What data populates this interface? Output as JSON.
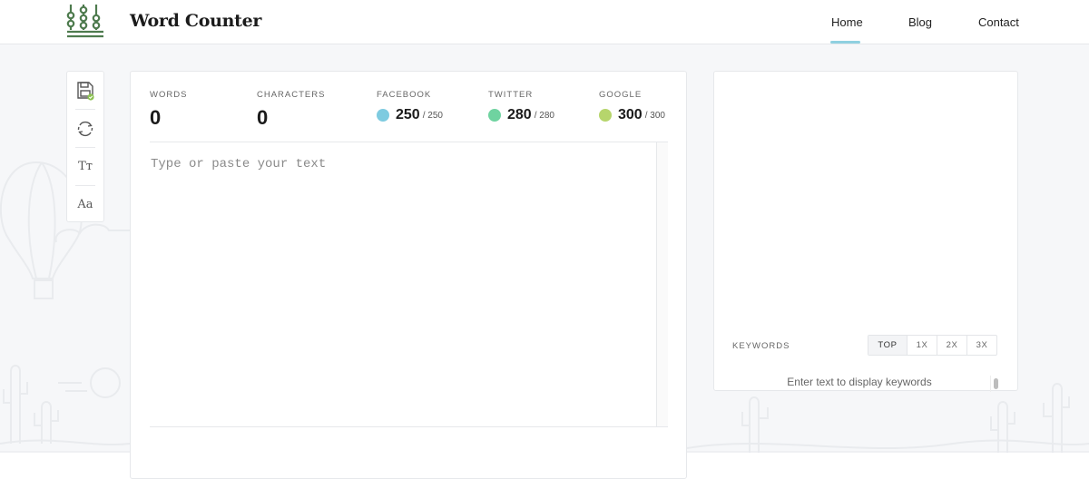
{
  "header": {
    "brand": "Word Counter",
    "nav": {
      "home": "Home",
      "blog": "Blog",
      "contact": "Contact"
    }
  },
  "toolbar": {
    "items": [
      {
        "icon": "save-icon"
      },
      {
        "icon": "refresh-icon"
      },
      {
        "label": "Tт",
        "icon": "text-size-icon"
      },
      {
        "label": "Aa",
        "icon": "font-icon"
      }
    ]
  },
  "stats": {
    "words": {
      "label": "WORDS",
      "value": "0"
    },
    "characters": {
      "label": "CHARACTERS",
      "value": "0"
    },
    "facebook": {
      "label": "FACEBOOK",
      "value": "250",
      "max": "/ 250",
      "color": "#7ecbe0"
    },
    "twitter": {
      "label": "TWITTER",
      "value": "280",
      "max": "/ 280",
      "color": "#6fd3a0"
    },
    "google": {
      "label": "GOOGLE",
      "value": "300",
      "max": "/ 300",
      "color": "#b6d56c"
    }
  },
  "editor": {
    "placeholder": "Type or paste your text",
    "value": ""
  },
  "keywords": {
    "label": "KEYWORDS",
    "tabs": [
      "TOP",
      "1X",
      "2X",
      "3X"
    ],
    "empty_text": "Enter text to display keywords"
  },
  "colors": {
    "brand_green": "#4e7b4e",
    "accent": "#8fd0e0",
    "border": "#e6e8eb"
  }
}
